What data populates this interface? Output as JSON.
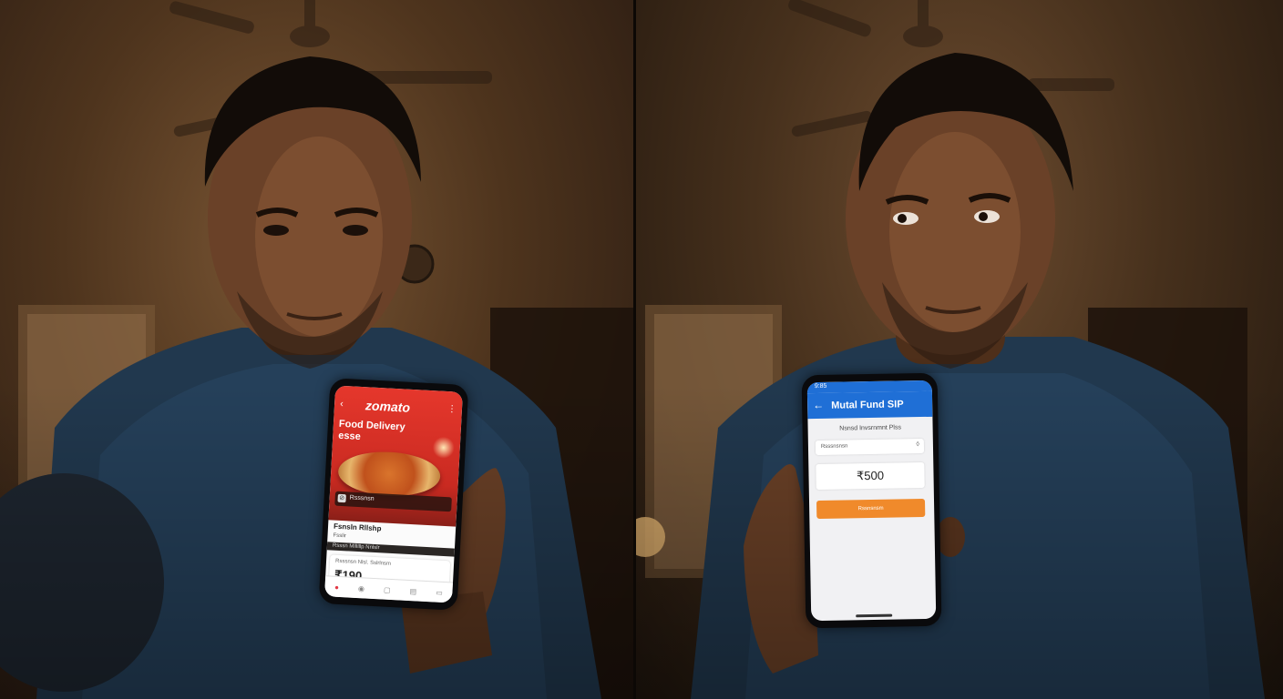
{
  "left_panel": {
    "phone": {
      "app_logo": "zomato",
      "headline": "Food Delivery",
      "headline_line2": "esse",
      "badge_text": "Rsssnsn",
      "restaurant_name": "Fsnsln Rllshp",
      "restaurant_sub": "Fsslir",
      "strip_text": "Rsssn Mllllllp Nnlslr",
      "card_label": "Rsssnsn Nlsl. Sslrlnsm",
      "price": "₹190",
      "nav": [
        "●",
        "◉",
        "▢",
        "▤",
        "▭"
      ]
    }
  },
  "right_panel": {
    "phone": {
      "status_time": "9:85",
      "title": "Mutal Fund SIP",
      "subtitle": "Nsnsd Invsrnmnt Plss",
      "select_placeholder": "Rsssnsnsn",
      "select_icon": "◊",
      "amount": "₹500",
      "button_label": "Rssnsnsm"
    }
  },
  "colors": {
    "zomato_red": "#e23744",
    "mf_blue": "#1f6fd6",
    "mf_button": "#f08a2b",
    "room_warm": "#7a5634"
  }
}
